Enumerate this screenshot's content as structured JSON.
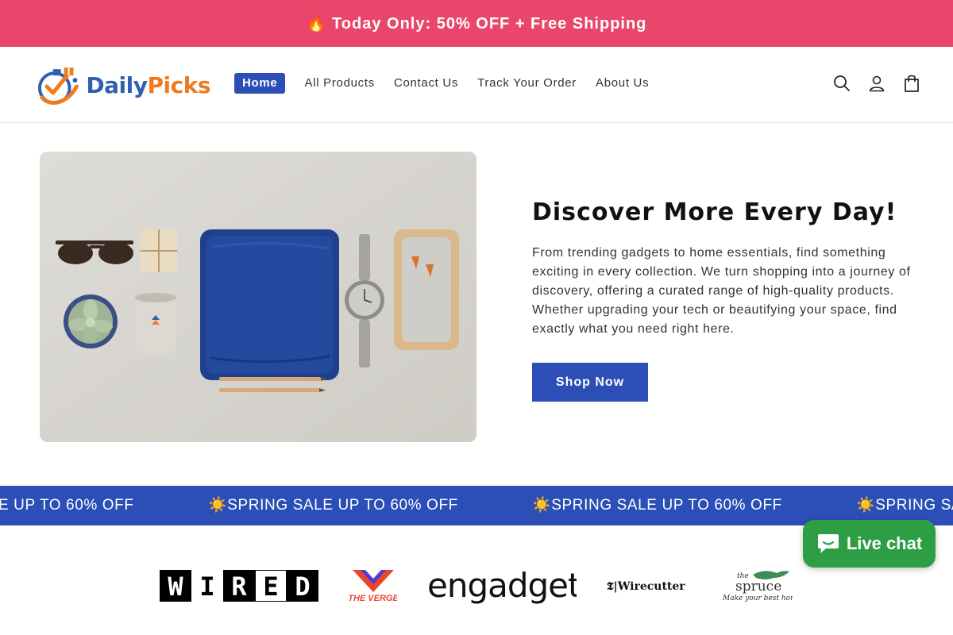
{
  "announcement": {
    "text": "🔥 Today Only: 50% OFF + Free Shipping",
    "bg_color": "#e8466a"
  },
  "brand": {
    "name_part1": "Daily",
    "name_part2": "Picks",
    "color_primary": "#2f5fb0",
    "color_secondary": "#f07b1f"
  },
  "nav": {
    "items": [
      {
        "label": "Home",
        "active": true
      },
      {
        "label": "All Products",
        "active": false
      },
      {
        "label": "Contact Us",
        "active": false
      },
      {
        "label": "Track Your Order",
        "active": false
      },
      {
        "label": "About Us",
        "active": false
      }
    ]
  },
  "header_icons": [
    "search-icon",
    "account-icon",
    "cart-icon"
  ],
  "hero": {
    "title": "Discover More Every Day!",
    "description": "From trending gadgets to home essentials, find something exciting in every collection. We turn shopping into a journey of discovery, offering a curated range of high-quality products. Whether upgrading your tech or beautifying your space, find exactly what you need right here.",
    "button_label": "Shop Now",
    "accent_color": "#2b4fb7"
  },
  "marquee": {
    "items": [
      "E UP TO 60% OFF",
      "☀️SPRING SALE UP TO 60% OFF",
      "☀️SPRING SALE UP TO 60% OFF",
      "☀️SPRING SA"
    ]
  },
  "press": {
    "logos": [
      "WIRED",
      "THE VERGE",
      "engadget",
      "Wirecutter",
      "the spruce"
    ],
    "spruce_tagline": "Make your best home"
  },
  "chat": {
    "label": "Live chat",
    "color": "#2e9e45"
  }
}
